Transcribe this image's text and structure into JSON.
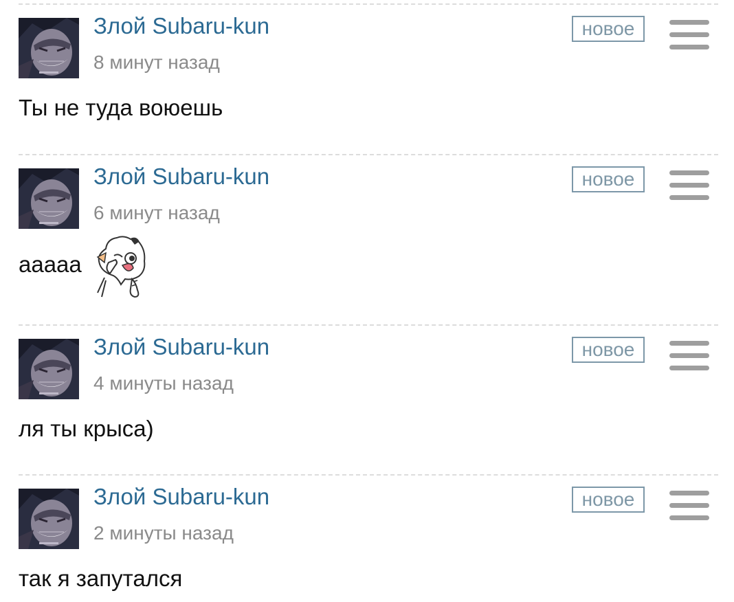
{
  "comments": [
    {
      "author": "Злой Subaru-kun",
      "time": "8 минут назад",
      "badge": "новое",
      "text": "Ты не туда воюешь",
      "has_sticker": false
    },
    {
      "author": "Злой Subaru-kun",
      "time": "6 минут назад",
      "badge": "новое",
      "text": "ааааа",
      "has_sticker": true,
      "sticker_icon": "cat-face-palm-sticker"
    },
    {
      "author": "Злой Subaru-kun",
      "time": "4 минуты назад",
      "badge": "новое",
      "text": "ля ты крыса)",
      "has_sticker": false
    },
    {
      "author": "Злой Subaru-kun",
      "time": "2 минуты назад",
      "badge": "новое",
      "text": "так я запутался",
      "has_sticker": false
    }
  ],
  "colors": {
    "author": "#2c6a93",
    "time": "#8a8a8a",
    "badge_border": "#7c97a8",
    "menu_icon": "#9e9e9e",
    "divider": "#dcdcdc"
  },
  "icons": {
    "menu": "hamburger-menu-icon",
    "avatar": "user-avatar"
  }
}
